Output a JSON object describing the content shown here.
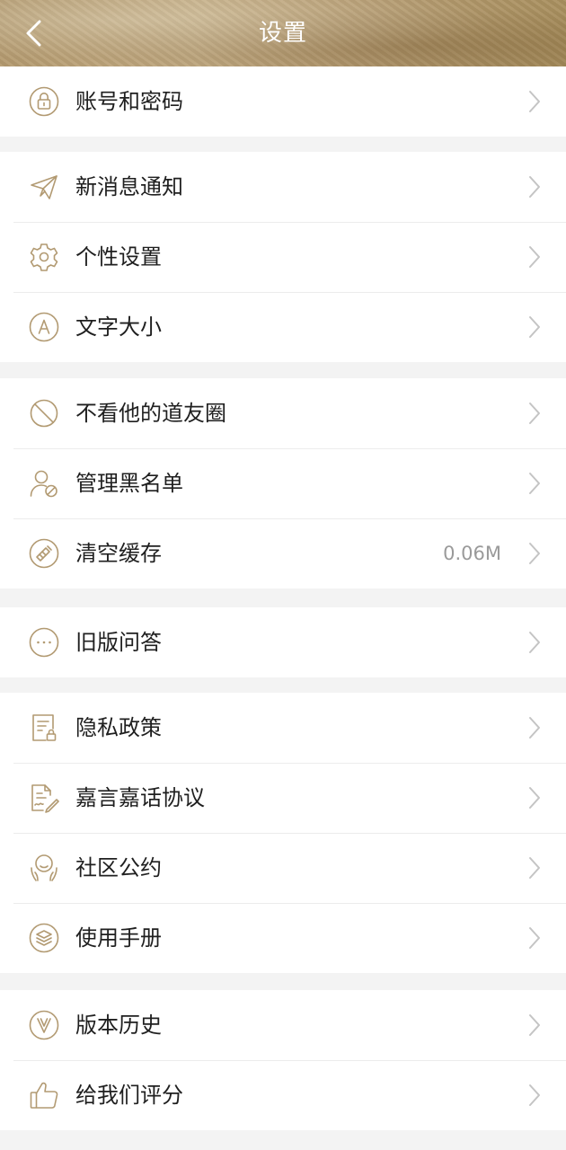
{
  "header": {
    "title": "设置",
    "back_icon": "chevron-left-icon"
  },
  "colors": {
    "header_bg": "#b59c72",
    "icon_stroke": "#b29a72",
    "text": "#1f1f1f",
    "secondary_text": "#9a9a9a",
    "chevron": "#c4c4c4",
    "page_bg": "#f3f3f3"
  },
  "sections": [
    {
      "items": [
        {
          "label": "账号和密码",
          "icon": "lock-icon"
        }
      ]
    },
    {
      "items": [
        {
          "label": "新消息通知",
          "icon": "paper-plane-icon"
        },
        {
          "label": "个性设置",
          "icon": "gear-icon"
        },
        {
          "label": "文字大小",
          "icon": "font-size-icon"
        }
      ]
    },
    {
      "items": [
        {
          "label": "不看他的道友圈",
          "icon": "block-icon"
        },
        {
          "label": "管理黑名单",
          "icon": "user-block-icon"
        },
        {
          "label": "清空缓存",
          "icon": "clear-cache-icon",
          "value": "0.06M"
        }
      ]
    },
    {
      "items": [
        {
          "label": "旧版问答",
          "icon": "more-dots-icon"
        }
      ]
    },
    {
      "items": [
        {
          "label": "隐私政策",
          "icon": "privacy-doc-icon"
        },
        {
          "label": "嘉言嘉话协议",
          "icon": "agreement-icon"
        },
        {
          "label": "社区公约",
          "icon": "community-icon"
        },
        {
          "label": "使用手册",
          "icon": "layers-icon"
        }
      ]
    },
    {
      "items": [
        {
          "label": "版本历史",
          "icon": "version-icon"
        },
        {
          "label": "给我们评分",
          "icon": "thumbs-up-icon"
        }
      ]
    }
  ]
}
